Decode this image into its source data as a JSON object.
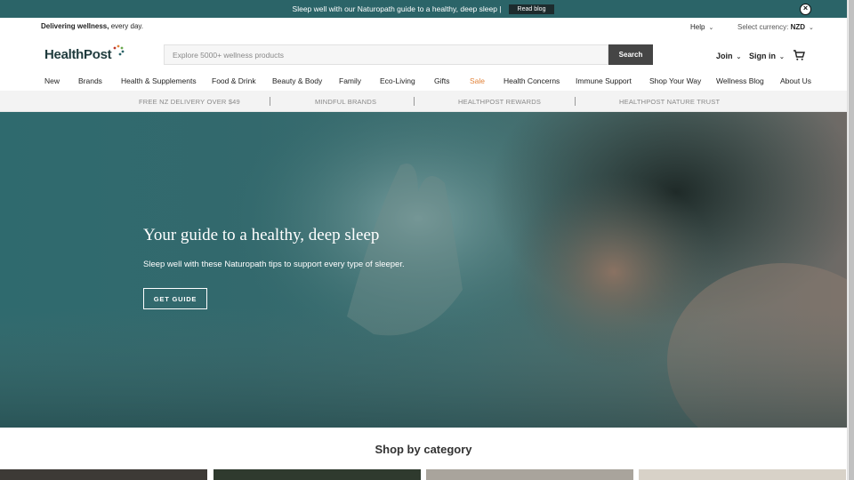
{
  "announcement": {
    "text": "Sleep well with our Naturopath guide to a healthy, deep sleep |",
    "button": "Read blog"
  },
  "utility": {
    "tagline_bold": "Delivering wellness,",
    "tagline_rest": " every day.",
    "help": "Help",
    "currency_label": "Select currency:",
    "currency_value": "NZD"
  },
  "logo": {
    "text": "HealthPost"
  },
  "search": {
    "placeholder": "Explore 5000+ wellness products",
    "button": "Search"
  },
  "account": {
    "join": "Join",
    "signin": "Sign in"
  },
  "nav": {
    "items": [
      "New",
      "Brands",
      "Health & Supplements",
      "Food & Drink",
      "Beauty & Body",
      "Family",
      "Eco-Living",
      "Gifts",
      "Sale",
      "Health Concerns",
      "Immune Support",
      "Shop Your Way",
      "Wellness Blog",
      "About Us"
    ]
  },
  "usp": {
    "items": [
      "FREE NZ DELIVERY OVER $49",
      "MINDFUL BRANDS",
      "HEALTHPOST REWARDS",
      "HEALTHPOST NATURE TRUST"
    ]
  },
  "hero": {
    "title": "Your guide to a healthy, deep sleep",
    "subtitle": "Sleep well with these Naturopath tips to support every type of sleeper.",
    "button": "GET GUIDE"
  },
  "category": {
    "title": "Shop by category"
  },
  "colors": {
    "brand_teal": "#2b6468",
    "sale": "#e2833a",
    "search_button": "#454545"
  }
}
